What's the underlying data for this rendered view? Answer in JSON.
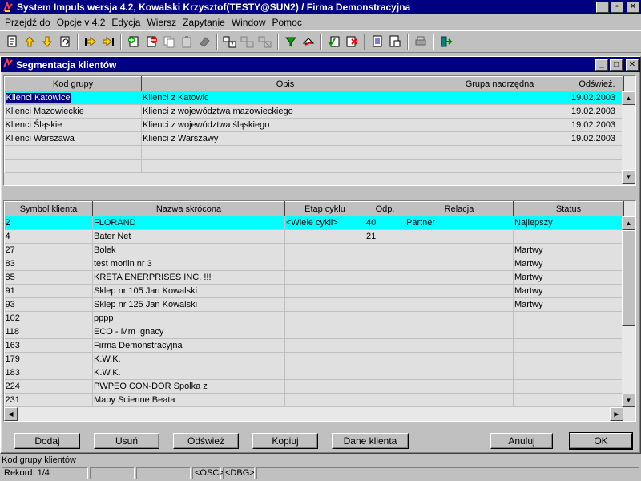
{
  "app": {
    "title": "System Impuls wersja 4.2, Kowalski Krzysztof(TESTY@SUN2) / Firma Demonstracyjna"
  },
  "menu": {
    "items": [
      "Przejdź do",
      "Opcje v 4.2",
      "Edycja",
      "Wiersz",
      "Zapytanie",
      "Window",
      "Pomoc"
    ]
  },
  "toolbar": {
    "icons": [
      "new-icon",
      "up-arrow-icon",
      "down-arrow-icon",
      "refresh-icon",
      "first-record-icon",
      "last-record-icon",
      "add-row-icon",
      "delete-row-icon",
      "copy-icon",
      "paste-icon",
      "eraser-icon",
      "query-icon",
      "query-run-icon",
      "query-cancel-icon",
      "filter-icon",
      "sort-icon",
      "mark-icon",
      "unmark-icon",
      "print-preview-icon",
      "report-icon",
      "printer-icon",
      "exit-icon"
    ]
  },
  "window": {
    "title": "Segmentacja klientów"
  },
  "groups_table": {
    "columns": [
      "Kod grupy",
      "Opis",
      "Grupa nadrzędna",
      "Odśwież."
    ],
    "rows": [
      [
        "Klienci Katowice",
        "Klienci z Katowic",
        "",
        "19.02.2003"
      ],
      [
        "Klienci Mazowieckie",
        "Klienci z województwa mazowieckiego",
        "",
        "19.02.2003"
      ],
      [
        "Klienci Śląskie",
        "Klienci z województwa śląskiego",
        "",
        "19.02.2003"
      ],
      [
        "Klienci Warszawa",
        "Klienci z Warszawy",
        "",
        "19.02.2003"
      ]
    ]
  },
  "clients_table": {
    "columns": [
      "Symbol klienta",
      "Nazwa skrócona",
      "Etap cyklu",
      "Odp.",
      "Relacja",
      "Status"
    ],
    "rows": [
      [
        "2",
        "FLORAND",
        "<Wiele cykli>",
        "40",
        "Partner",
        "Najlepszy"
      ],
      [
        "4",
        "Bater Net",
        "",
        "21",
        "",
        ""
      ],
      [
        "27",
        "Bolek",
        "",
        "",
        "",
        "Martwy"
      ],
      [
        "83",
        "test morlin nr 3",
        "",
        "",
        "",
        "Martwy"
      ],
      [
        "85",
        "KRETA ENERPRISES INC. !!!",
        "",
        "",
        "",
        "Martwy"
      ],
      [
        "91",
        "Sklep nr 105 Jan Kowalski",
        "",
        "",
        "",
        "Martwy"
      ],
      [
        "93",
        "Sklep nr 125 Jan Kowalski",
        "",
        "",
        "",
        "Martwy"
      ],
      [
        "102",
        "pppp",
        "",
        "",
        "",
        ""
      ],
      [
        "118",
        "ECO - Mm Ignacy",
        "",
        "",
        "",
        ""
      ],
      [
        "163",
        "Firma Demonstracyjna",
        "",
        "",
        "",
        ""
      ],
      [
        "179",
        "K.W.K.",
        "",
        "",
        "",
        ""
      ],
      [
        "183",
        "K.W.K.",
        "",
        "",
        "",
        ""
      ],
      [
        "224",
        "PWPEO CON-DOR Spolka z",
        "",
        "",
        "",
        ""
      ],
      [
        "231",
        "Mapy Scienne Beata",
        "",
        "",
        "",
        ""
      ]
    ]
  },
  "buttons": {
    "add": "Dodaj",
    "delete": "Usuń",
    "refresh": "Odśwież",
    "copy": "Kopiuj",
    "client_data": "Dane klienta",
    "cancel": "Anuluj",
    "ok": "OK"
  },
  "status": {
    "hint": "Kod grupy klientów",
    "record": "Rekord: 1/4",
    "osc": "<OSC>",
    "dbg": "<DBG>"
  },
  "colors": {
    "titlebar": "#000080",
    "selected_row": "#00ffff",
    "face": "#c0c0c0"
  }
}
